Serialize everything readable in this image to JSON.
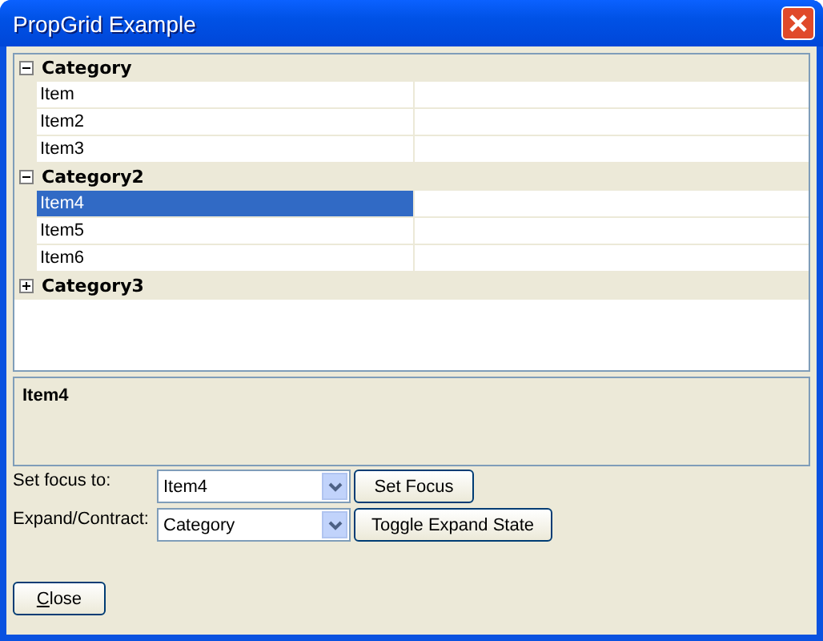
{
  "window": {
    "title": "PropGrid Example"
  },
  "grid": {
    "categories": [
      {
        "label": "Category",
        "expanded": true,
        "items": [
          {
            "label": "Item",
            "selected": false
          },
          {
            "label": "Item2",
            "selected": false
          },
          {
            "label": "Item3",
            "selected": false
          }
        ]
      },
      {
        "label": "Category2",
        "expanded": true,
        "items": [
          {
            "label": "Item4",
            "selected": true
          },
          {
            "label": "Item5",
            "selected": false
          },
          {
            "label": "Item6",
            "selected": false
          }
        ]
      },
      {
        "label": "Category3",
        "expanded": false
      }
    ]
  },
  "description": {
    "title": "Item4"
  },
  "controls": [
    {
      "label": "Set focus to:",
      "value": "Item4",
      "button": "Set Focus"
    },
    {
      "label": "Expand/Contract:",
      "value": "Category",
      "button": "Toggle Expand State"
    }
  ],
  "close_button": "Close"
}
